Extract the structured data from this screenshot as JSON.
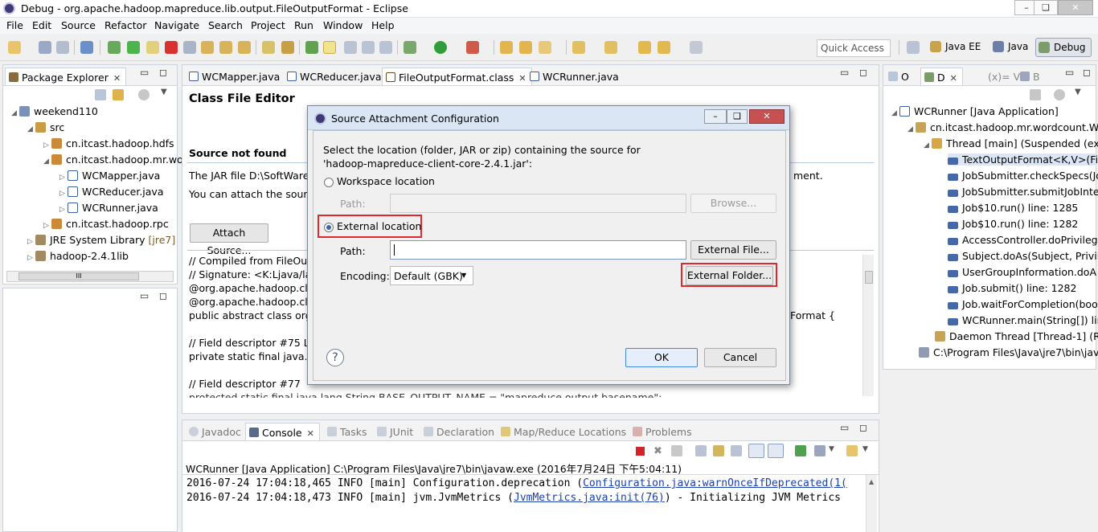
{
  "window": {
    "title": "Debug - org.apache.hadoop.mapreduce.lib.output.FileOutputFormat - Eclipse",
    "controls": [
      "–",
      "❑",
      "✕"
    ]
  },
  "menu": [
    "File",
    "Edit",
    "Source",
    "Refactor",
    "Navigate",
    "Search",
    "Project",
    "Run",
    "Window",
    "Help"
  ],
  "toolbar": {
    "quick_access": "Quick Access",
    "perspectives": [
      "Java EE",
      "Java",
      "Debug"
    ]
  },
  "package_explorer": {
    "tab": "Package Explorer",
    "items": [
      {
        "label": "weekend110"
      },
      {
        "label": "src"
      },
      {
        "label": "cn.itcast.hadoop.hdfs"
      },
      {
        "label": "cn.itcast.hadoop.mr.wo"
      },
      {
        "label": "WCMapper.java"
      },
      {
        "label": "WCReducer.java"
      },
      {
        "label": "WCRunner.java"
      },
      {
        "label": "cn.itcast.hadoop.rpc"
      },
      {
        "label": "JRE System Library",
        "suffix": "[jre7]"
      },
      {
        "label": "hadoop-2.4.1lib"
      }
    ],
    "scroll_label": "III"
  },
  "editor": {
    "tabs": [
      "WCMapper.java",
      "WCReducer.java",
      "FileOutputFormat.class",
      "WCRunner.java"
    ],
    "heading": "Class File Editor",
    "source_not_found": "Source not found",
    "jar_line": "The JAR file D:\\SoftWare\\",
    "jar_line_end": "ment.",
    "attach_line": "You can attach the source",
    "attach_button": "Attach Source...",
    "code": [
      "// Compiled from FileOut",
      "// Signature: <K:Ljava/lan",
      "@org.apache.hadoop.cla",
      "@org.apache.hadoop.cla",
      "public abstract class org.",
      "",
      "  // Field descriptor #75 L",
      "  private static final java.te",
      "",
      "  // Field descriptor #77",
      "  protected static final java.lang.String BASE_OUTPUT_NAME = \"mapreduce.output.basename\";"
    ],
    "code_right": "Format {"
  },
  "dialog": {
    "title": "Source Attachment Configuration",
    "description_line1": "Select the location (folder, JAR or zip) containing the source for",
    "description_line2": "'hadoop-mapreduce-client-core-2.4.1.jar':",
    "workspace_label": "Workspace location",
    "path_label": "Path:",
    "browse": "Browse...",
    "external_label": "External location",
    "external_path_label": "Path:",
    "external_path_value": "",
    "external_file": "External File...",
    "encoding_label": "Encoding:",
    "encoding_value": "Default (GBK)",
    "external_folder": "External Folder...",
    "help": "?",
    "ok": "OK",
    "cancel": "Cancel"
  },
  "debug_view": {
    "tabs": [
      "O",
      "D",
      "(x)= V",
      "B"
    ],
    "items": [
      "WCRunner [Java Application]",
      "cn.itcast.hadoop.mr.wordcount.W",
      "Thread [main] (Suspended (exc",
      "TextOutputFormat<K,V>(Fil",
      "JobSubmitter.checkSpecs(Jo",
      "JobSubmitter.submitJobInte",
      "Job$10.run() line: 1285",
      "Job$10.run() line: 1282",
      "AccessController.doPrivileg",
      "Subject.doAs(Subject, Privile",
      "UserGroupInformation.doA",
      "Job.submit() line: 1282",
      "Job.waitForCompletion(boo",
      "WCRunner.main(String[]) lin",
      "Daemon Thread [Thread-1] (Ru",
      "C:\\Program Files\\Java\\jre7\\bin\\jav"
    ]
  },
  "console": {
    "tabs": [
      "Javadoc",
      "Console",
      "Tasks",
      "JUnit",
      "Declaration",
      "Map/Reduce Locations",
      "Problems"
    ],
    "header": "WCRunner [Java Application] C:\\Program Files\\Java\\jre7\\bin\\javaw.exe (2016年7月24日 下午5:04:11)",
    "lines": [
      {
        "prefix": "2016-07-24 17:04:18,465 INFO  [main] Configuration.deprecation (",
        "link": "Configuration.java:warnOnceIfDeprecated(1(",
        "suffix": ""
      },
      {
        "prefix": "2016-07-24 17:04:18,473 INFO  [main] jvm.JvmMetrics (",
        "link": "JvmMetrics.java:init(76)",
        "suffix": ") - Initializing JVM Metrics"
      }
    ]
  }
}
